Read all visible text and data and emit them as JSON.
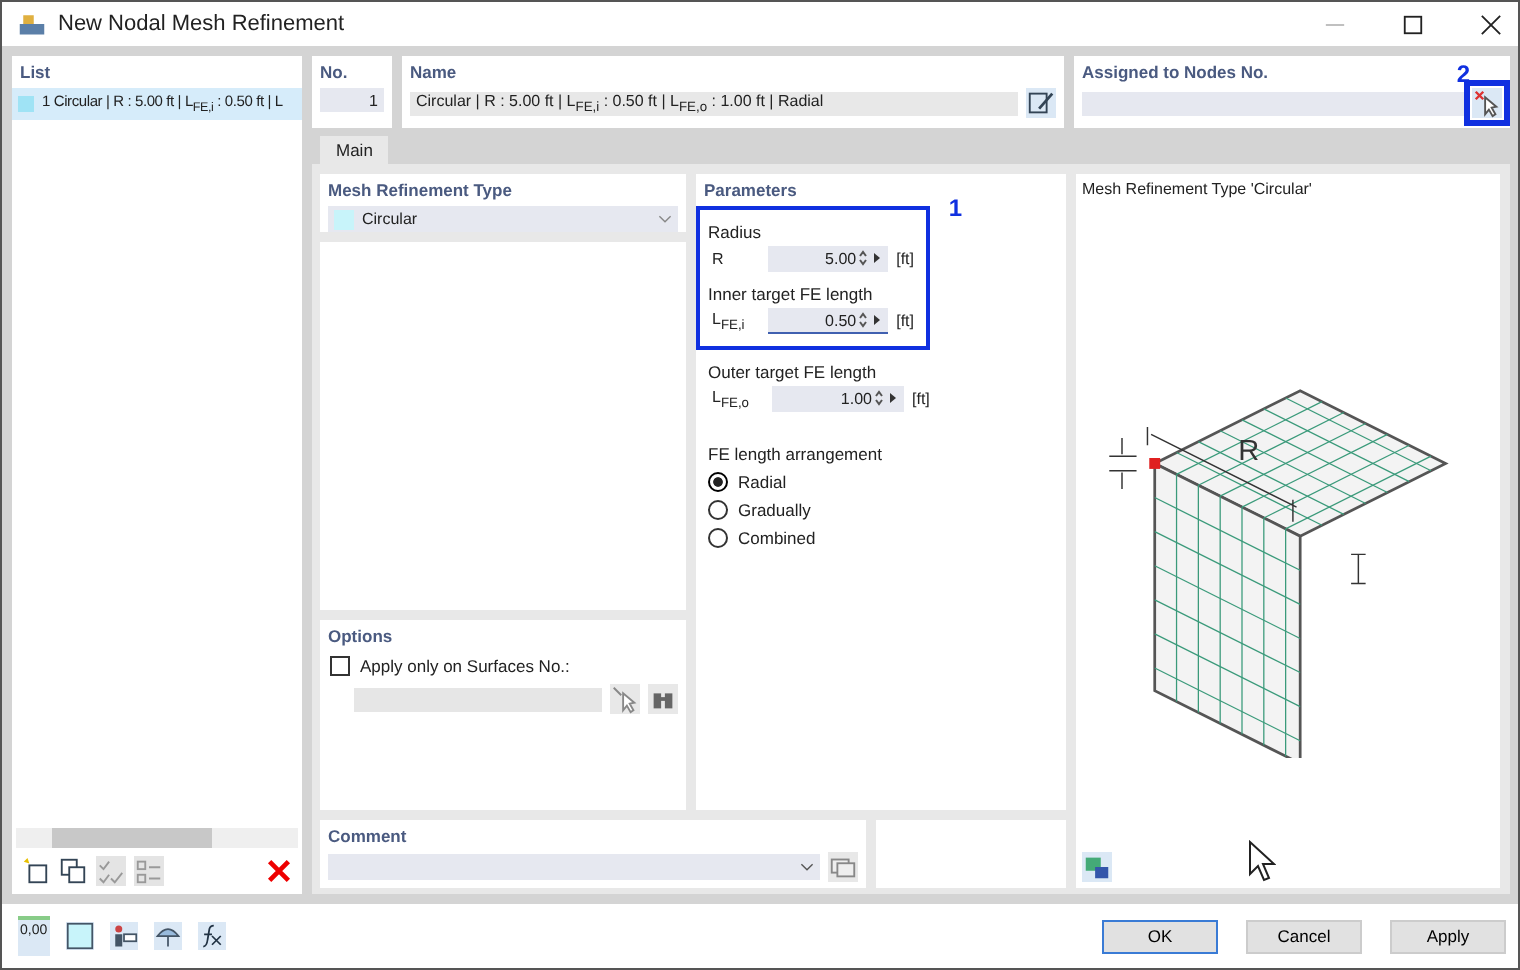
{
  "window": {
    "title": "New Nodal Mesh Refinement"
  },
  "list": {
    "title": "List",
    "items": [
      {
        "label": "1 Circular | R : 5.00 ft | L$_{FE,i}$ : 0.50 ft | L",
        "color": "#9fe3f5",
        "selected": true
      }
    ]
  },
  "number": {
    "label": "No.",
    "value": "1"
  },
  "name": {
    "label": "Name",
    "value": "Circular | R : 5.00 ft | L$_{FE,i}$ : 0.50 ft | L$_{FE,o}$ : 1.00 ft | Radial"
  },
  "assigned": {
    "label": "Assigned to Nodes No.",
    "marker": "2"
  },
  "tabs": [
    {
      "label": "Main",
      "selected": true
    }
  ],
  "mesh_type": {
    "label": "Mesh Refinement Type",
    "value": "Circular",
    "color": "#c8f4fa"
  },
  "parameters": {
    "title": "Parameters",
    "sections": [
      {
        "marker": "1",
        "fields": [
          {
            "heading": "Radius",
            "symbol": "R",
            "value": "5.00",
            "unit": "[ft]",
            "focused": false
          },
          {
            "heading": "Inner target FE length",
            "symbol": "L$_{FE,i}$",
            "value": "0.50",
            "unit": "[ft]",
            "focused": true
          }
        ]
      },
      {
        "fields": [
          {
            "heading": "Outer target FE length",
            "symbol": "L$_{FE,o}$",
            "value": "1.00",
            "unit": "[ft]",
            "focused": false
          }
        ]
      }
    ],
    "arrangement": {
      "title": "FE length arrangement",
      "options": [
        {
          "label": "Radial",
          "selected": true
        },
        {
          "label": "Gradually",
          "selected": false
        },
        {
          "label": "Combined",
          "selected": false
        }
      ]
    }
  },
  "options": {
    "title": "Options",
    "checkbox": {
      "label": "Apply only on Surfaces No.:",
      "checked": false
    }
  },
  "comment": {
    "label": "Comment"
  },
  "preview": {
    "title": "Mesh Refinement Type 'Circular'",
    "dimension_label": "R"
  },
  "units_icon_text": "0,00",
  "buttons": [
    {
      "label": "OK",
      "default": true
    },
    {
      "label": "Cancel",
      "default": false
    },
    {
      "label": "Apply",
      "default": false
    }
  ]
}
